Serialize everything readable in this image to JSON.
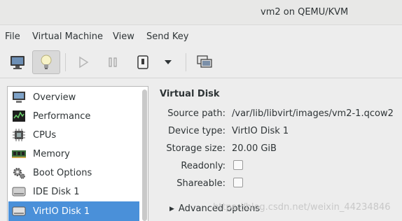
{
  "window": {
    "title": "vm2 on QEMU/KVM"
  },
  "menubar": {
    "items": [
      "File",
      "Virtual Machine",
      "View",
      "Send Key"
    ]
  },
  "toolbar": {
    "buttons": [
      "console-monitor-icon",
      "details-lightbulb-icon",
      "run-icon",
      "pause-icon",
      "shutdown-icon",
      "dropdown-arrow-icon",
      "snapshots-icon"
    ],
    "active": "details-lightbulb-icon"
  },
  "sidebar": {
    "items": [
      {
        "label": "Overview",
        "icon": "overview-monitor-icon"
      },
      {
        "label": "Performance",
        "icon": "performance-graph-icon"
      },
      {
        "label": "CPUs",
        "icon": "cpu-chip-icon"
      },
      {
        "label": "Memory",
        "icon": "memory-module-icon"
      },
      {
        "label": "Boot Options",
        "icon": "gear-icon"
      },
      {
        "label": "IDE Disk 1",
        "icon": "disk-icon"
      },
      {
        "label": "VirtIO Disk 1",
        "icon": "disk-icon"
      }
    ],
    "selected_index": 6
  },
  "details": {
    "heading": "Virtual Disk",
    "source_path_label": "Source path:",
    "source_path_value": "/var/lib/libvirt/images/vm2-1.qcow2",
    "device_type_label": "Device type:",
    "device_type_value": "VirtIO Disk 1",
    "storage_size_label": "Storage size:",
    "storage_size_value": "20.00 GiB",
    "readonly_label": "Readonly:",
    "readonly_checked": false,
    "shareable_label": "Shareable:",
    "shareable_checked": false,
    "advanced_label": "Advanced options"
  },
  "watermark": "https://blog.csdn.net/weixin_44234846",
  "colors": {
    "selection": "#4a90d9",
    "background": "#ededed"
  }
}
